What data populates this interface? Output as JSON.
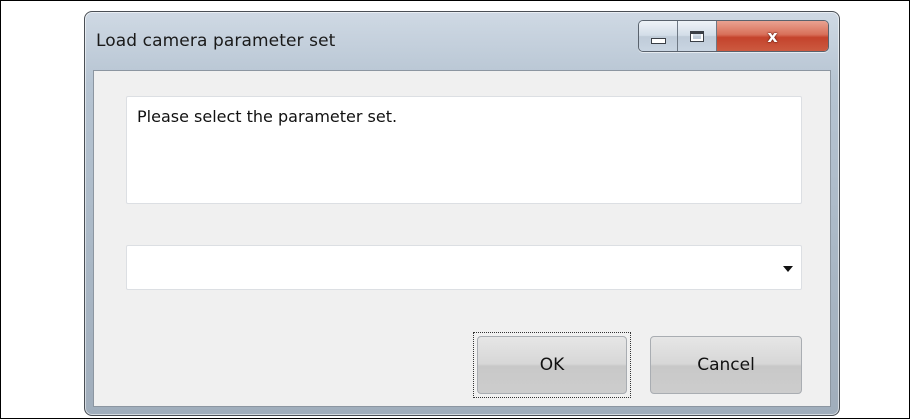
{
  "window": {
    "title": "Load camera parameter set",
    "caption_buttons": {
      "minimize_icon": "minimize-icon",
      "maximize_icon": "maximize-icon",
      "close_icon": "close-icon",
      "close_glyph": "x"
    }
  },
  "dialog": {
    "message": "Please select the parameter set.",
    "parameter_set_select": {
      "selected_value": ""
    },
    "buttons": {
      "ok_label": "OK",
      "cancel_label": "Cancel"
    }
  },
  "colors": {
    "close_button": "#c4432c",
    "window_frame": "#aab8c6",
    "client_background": "#f0f0f0"
  }
}
